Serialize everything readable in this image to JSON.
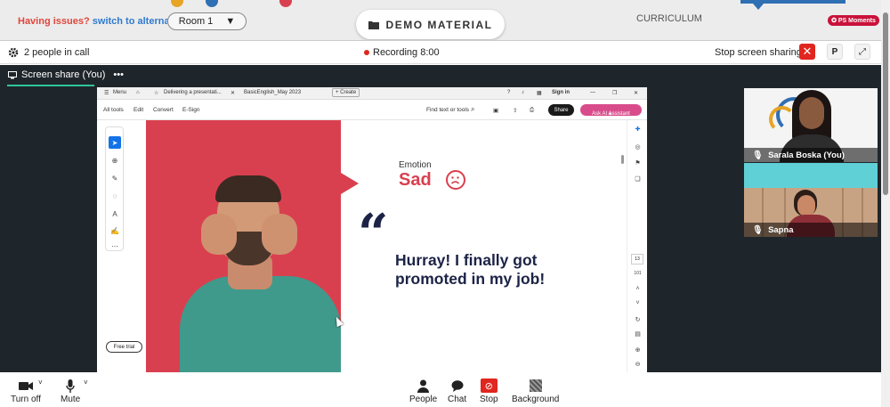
{
  "topbar": {
    "issues_text": "Having issues?",
    "switch_link": "switch to alternate room",
    "room_value": "Room 1",
    "demo_label": "DEMO MATERIAL",
    "curriculum_label": "CURRICULUM",
    "moments_label": "PS Moments"
  },
  "callbar": {
    "people_count": "2 people in call",
    "recording_label": "Recording 8:00",
    "stop_sharing_label": "Stop screen sharing",
    "p_label": "P"
  },
  "stage": {
    "title": "Screen share (You)"
  },
  "acrobat": {
    "menu_label": "Menu",
    "tab1": "Delivering a presentati...",
    "tab2": "BasicEnglish_May 2023",
    "create_label": "+ Create",
    "sign_in": "Sign in",
    "all_tools": "All tools",
    "edit": "Edit",
    "convert": "Convert",
    "esign": "E-Sign",
    "find_text": "Find text or tools",
    "share": "Share",
    "ai_assistant": "Ask AI Assistant",
    "free_trial": "Free trial",
    "page_current": "13",
    "page_total": "101"
  },
  "slide": {
    "emotion_label": "Emotion",
    "emotion_value": "Sad",
    "quote": "Hurray! I finally got promoted in my job!"
  },
  "participants": [
    {
      "name": "Sarala Boska (You)"
    },
    {
      "name": "Sapna"
    }
  ],
  "bottombar": {
    "turn_off": "Turn off",
    "mute": "Mute",
    "people": "People",
    "chat": "Chat",
    "stop": "Stop",
    "background": "Background"
  },
  "colors": {
    "slide_red": "#d9404f",
    "quote_navy": "#1c2346",
    "stop_red": "#e0261f",
    "teal_accent": "#2fc4a0"
  }
}
